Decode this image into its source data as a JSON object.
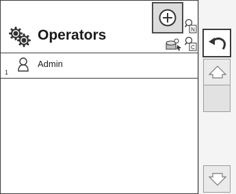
{
  "header": {
    "title": "Operators",
    "icons": {
      "title": "gears-icon",
      "add": "add-circle-icon",
      "search_name": "search-by-name-icon",
      "search_code": "search-by-code-icon",
      "preset": "preset-load-icon"
    },
    "search_name_letter": "N",
    "search_code_letter": "C"
  },
  "operators": [
    {
      "index": "1",
      "name": "Admin",
      "icon": "person-icon"
    }
  ],
  "sidebar": {
    "back_icon": "undo-arrow-icon",
    "up_icon": "arrow-up-icon",
    "down_icon": "arrow-down-icon"
  }
}
